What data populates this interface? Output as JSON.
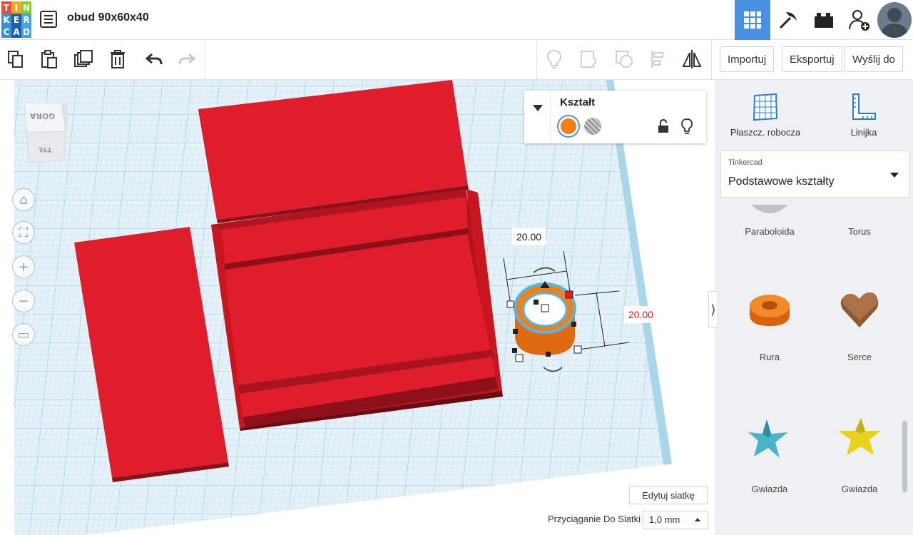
{
  "app": {
    "logo_letters": [
      "T",
      "I",
      "N",
      "K",
      "E",
      "R",
      "C",
      "A",
      "D"
    ],
    "document_title": "obud 90x60x40",
    "accent_color": "#4a90e2",
    "shape_color": "#e01e2b",
    "selected_color": "#f57f17"
  },
  "header": {
    "menu_icon": "list-icon",
    "views": [
      {
        "icon": "grid-view-icon",
        "active": true
      },
      {
        "icon": "pickaxe-icon",
        "active": false
      },
      {
        "icon": "bricks-icon",
        "active": false
      },
      {
        "icon": "add-user-icon",
        "active": false
      }
    ],
    "avatar_icon": "user-avatar"
  },
  "toolbar": {
    "left_icons": [
      "copy-icon",
      "paste-icon",
      "duplicate-icon",
      "trash-icon",
      "undo-icon",
      "redo-icon"
    ],
    "right_icons": [
      "lightbulb-icon",
      "group-icon",
      "ungroup-icon",
      "align-icon",
      "mirror-icon"
    ],
    "import_label": "Importuj",
    "export_label": "Eksportuj",
    "send_label": "Wyślij do"
  },
  "viewcube": {
    "top_label": "GÓRA",
    "front_label": "TYŁ"
  },
  "nav_controls": [
    "home-icon",
    "fit-icon",
    "zoom-in-icon",
    "zoom-out-icon",
    "ortho-icon"
  ],
  "shape_panel": {
    "title": "Kształt",
    "solid_label": "Solid",
    "hole_label": "Hole",
    "lock_icon": "lock-open-icon",
    "light_icon": "lightbulb-icon"
  },
  "dimensions": {
    "width": "20.00",
    "depth": "20.00"
  },
  "sidebar": {
    "tools": [
      {
        "label": "Płaszcz. robocza",
        "icon": "workplane-icon"
      },
      {
        "label": "Linijka",
        "icon": "ruler-icon"
      }
    ],
    "library": {
      "category": "Tinkercad",
      "selected": "Podstawowe kształty"
    },
    "shapes": [
      {
        "label": "Paraboloida",
        "icon": "paraboloid-icon"
      },
      {
        "label": "Torus",
        "icon": "torus-icon"
      },
      {
        "label": "Rura",
        "icon": "tube-icon"
      },
      {
        "label": "Serce",
        "icon": "heart-icon"
      },
      {
        "label": "Gwiazda",
        "icon": "star-teal-icon"
      },
      {
        "label": "Gwiazda",
        "icon": "star-yellow-icon"
      }
    ],
    "collapse_glyph": "⟩"
  },
  "bottom": {
    "edit_grid_label": "Edytuj siatkę",
    "snap_label": "Przyciąganie Do Siatki",
    "snap_value": "1,0 mm"
  }
}
